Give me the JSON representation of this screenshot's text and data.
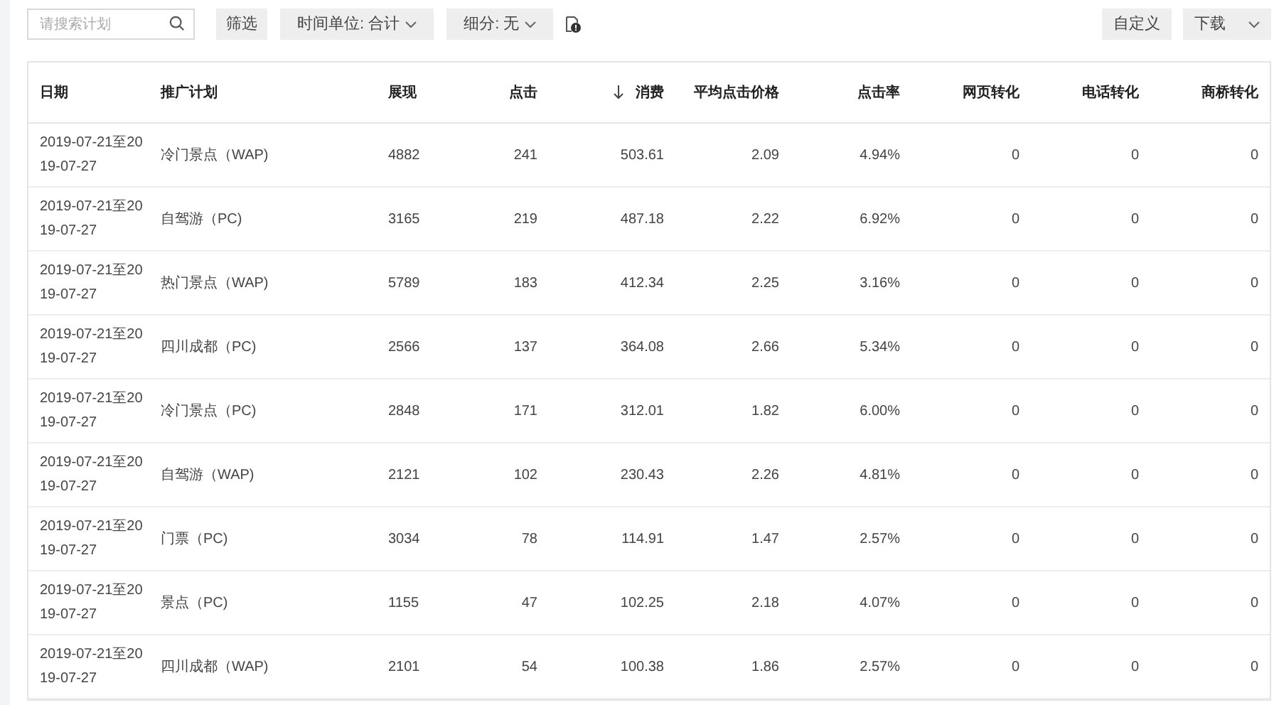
{
  "toolbar": {
    "search": {
      "placeholder": "请搜索计划"
    },
    "filter_button": "筛选",
    "dropdowns": [
      {
        "label": "时间单位: 合计"
      },
      {
        "label": "细分: 无"
      }
    ],
    "customize_button": "自定义",
    "download": {
      "label": "下载"
    }
  },
  "table": {
    "columns": [
      {
        "label": "日期",
        "sorted": false
      },
      {
        "label": "推广计划",
        "sorted": false
      },
      {
        "label": "展现",
        "sorted": false
      },
      {
        "label": "点击",
        "sorted": false
      },
      {
        "label": "消费",
        "sorted": true
      },
      {
        "label": "平均点击价格",
        "sorted": false
      },
      {
        "label": "点击率",
        "sorted": false
      },
      {
        "label": "网页转化",
        "sorted": false
      },
      {
        "label": "电话转化",
        "sorted": false
      },
      {
        "label": "商桥转化",
        "sorted": false
      }
    ],
    "rows": [
      [
        "2019-07-21至2019-07-27",
        "冷门景点（WAP)",
        "4882",
        "241",
        "503.61",
        "2.09",
        "4.94%",
        "0",
        "0",
        "0"
      ],
      [
        "2019-07-21至2019-07-27",
        "自驾游（PC)",
        "3165",
        "219",
        "487.18",
        "2.22",
        "6.92%",
        "0",
        "0",
        "0"
      ],
      [
        "2019-07-21至2019-07-27",
        "热门景点（WAP)",
        "5789",
        "183",
        "412.34",
        "2.25",
        "3.16%",
        "0",
        "0",
        "0"
      ],
      [
        "2019-07-21至2019-07-27",
        "四川成都（PC)",
        "2566",
        "137",
        "364.08",
        "2.66",
        "5.34%",
        "0",
        "0",
        "0"
      ],
      [
        "2019-07-21至2019-07-27",
        "冷门景点（PC)",
        "2848",
        "171",
        "312.01",
        "1.82",
        "6.00%",
        "0",
        "0",
        "0"
      ],
      [
        "2019-07-21至2019-07-27",
        "自驾游（WAP)",
        "2121",
        "102",
        "230.43",
        "2.26",
        "4.81%",
        "0",
        "0",
        "0"
      ],
      [
        "2019-07-21至2019-07-27",
        "门票（PC)",
        "3034",
        "78",
        "114.91",
        "1.47",
        "2.57%",
        "0",
        "0",
        "0"
      ],
      [
        "2019-07-21至2019-07-27",
        "景点（PC)",
        "1155",
        "47",
        "102.25",
        "2.18",
        "4.07%",
        "0",
        "0",
        "0"
      ],
      [
        "2019-07-21至2019-07-27",
        "四川成都（WAP)",
        "2101",
        "54",
        "100.38",
        "1.86",
        "2.57%",
        "0",
        "0",
        "0"
      ]
    ]
  }
}
